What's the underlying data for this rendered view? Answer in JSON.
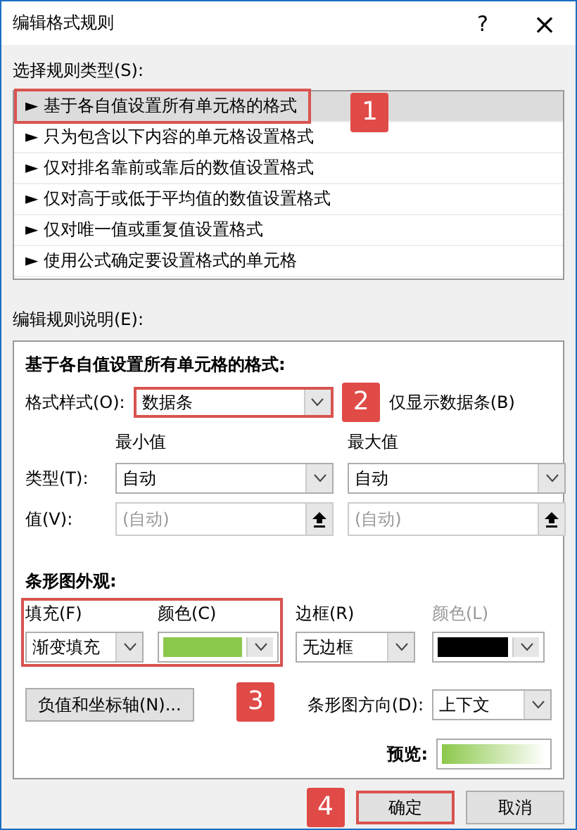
{
  "window": {
    "title": "编辑格式规则",
    "help": "?",
    "close": "×"
  },
  "rule_types": {
    "label": "选择规则类型(S):",
    "annotation": "1",
    "items": [
      {
        "marker": "►",
        "text": "基于各自值设置所有单元格的格式",
        "selected": true,
        "highlighted": true
      },
      {
        "marker": "►",
        "text": "只为包含以下内容的单元格设置格式",
        "selected": false,
        "highlighted": false
      },
      {
        "marker": "►",
        "text": "仅对排名靠前或靠后的数值设置格式",
        "selected": false,
        "highlighted": false
      },
      {
        "marker": "►",
        "text": "仅对高于或低于平均值的数值设置格式",
        "selected": false,
        "highlighted": false
      },
      {
        "marker": "►",
        "text": "仅对唯一值或重复值设置格式",
        "selected": false,
        "highlighted": false
      },
      {
        "marker": "►",
        "text": "使用公式确定要设置格式的单元格",
        "selected": false,
        "highlighted": false
      }
    ]
  },
  "description": {
    "label": "编辑规则说明(E):",
    "heading": "基于各自值设置所有单元格的格式:",
    "format_style": {
      "label": "格式样式(O):",
      "value": "数据条",
      "annotation": "2"
    },
    "bar_only": {
      "label": "仅显示数据条(B)"
    },
    "type_label": "类型(T):",
    "value_label": "值(V):",
    "min": {
      "header": "最小值",
      "type": "自动",
      "placeholder": "(自动)"
    },
    "max": {
      "header": "最大值",
      "type": "自动",
      "placeholder": "(自动)"
    },
    "appearance": {
      "heading": "条形图外观:",
      "annotation": "3",
      "fill": {
        "label": "填充(F)",
        "value": "渐变填充"
      },
      "fill_color": {
        "label": "颜色(C)",
        "color": "#8cc84b"
      },
      "border": {
        "label": "边框(R)",
        "value": "无边框"
      },
      "border_color": {
        "label": "颜色(L)",
        "color": "#000000",
        "disabled": true
      },
      "negative_button": "负值和坐标轴(N)...",
      "direction": {
        "label": "条形图方向(D):",
        "value": "上下文"
      },
      "preview": {
        "label": "预览:"
      }
    }
  },
  "footer": {
    "annotation": "4",
    "buttons": [
      "确定",
      "取消"
    ]
  }
}
